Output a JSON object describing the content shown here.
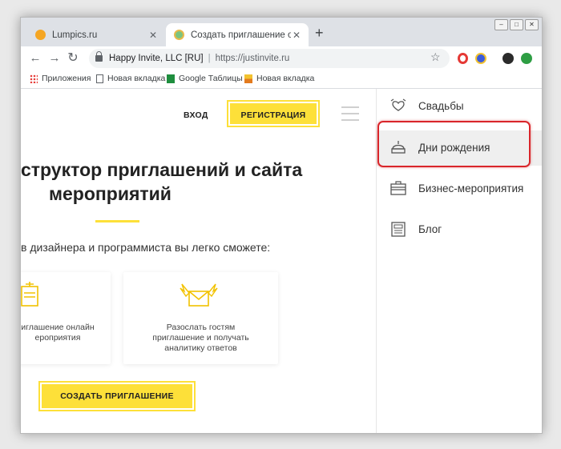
{
  "browser": {
    "tabs": [
      {
        "title": "Lumpics.ru",
        "favicon_color": "#f5a623",
        "active": false
      },
      {
        "title": "Создать приглашение онлайн и",
        "favicon_color": "#7cc47f",
        "active": true
      }
    ],
    "new_tab_symbol": "+",
    "window_buttons": [
      "–",
      "□",
      "✕"
    ],
    "address": {
      "site_name": "Happy Invite, LLC [RU]",
      "url": "https://justinvite.ru"
    },
    "bookmarks": [
      {
        "label": "Приложения",
        "icon": "apps-grid-icon"
      },
      {
        "label": "Новая вкладка",
        "icon": "page-icon"
      },
      {
        "label": "Google Таблицы",
        "icon": "sheets-icon"
      },
      {
        "label": "Новая вкладка",
        "icon": "image-icon"
      }
    ]
  },
  "page": {
    "nav": {
      "login": "ВХОД",
      "register": "РЕГИСТРАЦИЯ"
    },
    "headline_line1": "структор приглашений и сайта",
    "headline_line2": "мероприятий",
    "subtitle": "в дизайнера и программиста вы легко сможете:",
    "cards": [
      {
        "line1": "иглашение онлайн",
        "line2": "ероприятия",
        "icon": "invitation-icon"
      },
      {
        "line1": "Разослать гостям",
        "line2": "приглашение и получать",
        "line3": "аналитику ответов",
        "icon": "winged-envelope-icon"
      }
    ],
    "cta": "СОЗДАТЬ ПРИГЛАШЕНИЕ",
    "accent_color": "#fde039"
  },
  "side_menu": {
    "items": [
      {
        "label": "Свадьбы",
        "icon": "hearts-icon"
      },
      {
        "label": "Дни рождения",
        "icon": "cake-icon",
        "highlighted": true
      },
      {
        "label": "Бизнес-мероприятия",
        "icon": "briefcase-icon"
      },
      {
        "label": "Блог",
        "icon": "newspaper-icon"
      }
    ],
    "highlight_color": "#d9252a"
  }
}
